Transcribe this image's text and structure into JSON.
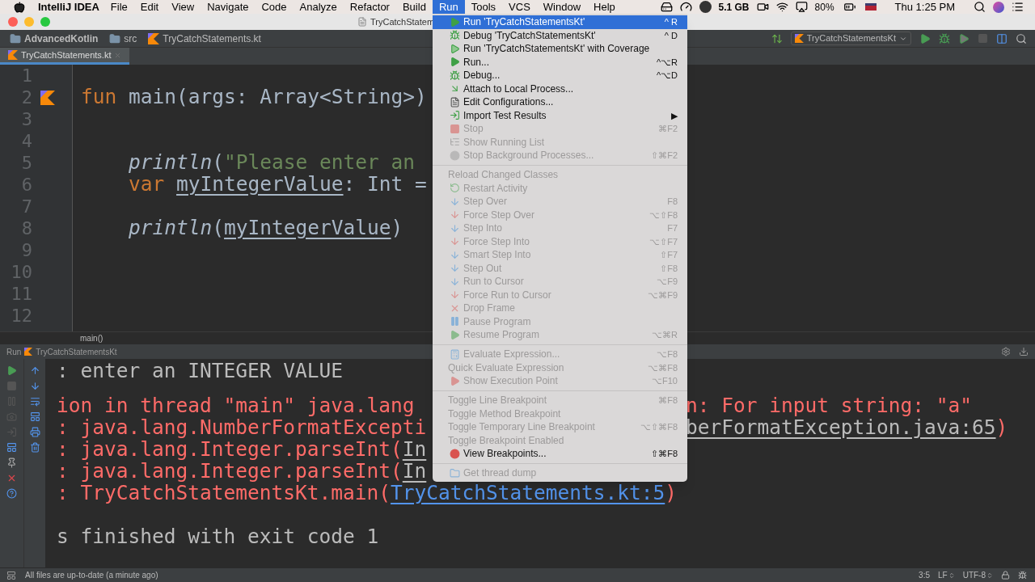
{
  "menubar": {
    "app_name": "IntelliJ IDEA",
    "items": [
      {
        "label": "File",
        "selected": false
      },
      {
        "label": "Edit",
        "selected": false
      },
      {
        "label": "View",
        "selected": false
      },
      {
        "label": "Navigate",
        "selected": false
      },
      {
        "label": "Code",
        "selected": false
      },
      {
        "label": "Analyze",
        "selected": false
      },
      {
        "label": "Refactor",
        "selected": false
      },
      {
        "label": "Build",
        "selected": false
      },
      {
        "label": "Run",
        "selected": true
      },
      {
        "label": "Tools",
        "selected": false
      },
      {
        "label": "VCS",
        "selected": false
      },
      {
        "label": "Window",
        "selected": false
      },
      {
        "label": "Help",
        "selected": false
      }
    ],
    "memory": "5.1 GB",
    "battery": "80%",
    "clock": "Thu 1:25 PM"
  },
  "window": {
    "title": "TryCatchStatem"
  },
  "navbar": {
    "breadcrumbs": [
      "AdvancedKotlin",
      "src",
      "TryCatchStatements.kt"
    ],
    "run_config": "TryCatchStatementsKt"
  },
  "tabs": [
    {
      "label": "TryCatchStatements.kt",
      "selected": true
    }
  ],
  "editor": {
    "lines": [
      {
        "number": "1",
        "run_marker": false
      },
      {
        "number": "2",
        "run_marker": true,
        "tokens": [
          {
            "text": "fun ",
            "kind": "keyword"
          },
          {
            "text": "main(args: Array<String>)",
            "kind": "plain"
          }
        ]
      },
      {
        "number": "3",
        "run_marker": false
      },
      {
        "number": "4",
        "run_marker": false
      },
      {
        "number": "5",
        "run_marker": false,
        "tokens": [
          {
            "text": "    println",
            "kind": "call"
          },
          {
            "text": "(",
            "kind": "plain"
          },
          {
            "text": "\"Please enter an",
            "kind": "string"
          }
        ]
      },
      {
        "number": "6",
        "run_marker": false,
        "tokens": [
          {
            "text": "    var ",
            "kind": "keyword"
          },
          {
            "text": "myIntegerValue",
            "kind": "variable"
          },
          {
            "text": ": Int =",
            "kind": "plain"
          }
        ]
      },
      {
        "number": "7",
        "run_marker": false
      },
      {
        "number": "8",
        "run_marker": false,
        "tokens": [
          {
            "text": "    println",
            "kind": "call"
          },
          {
            "text": "(",
            "kind": "plain"
          },
          {
            "text": "myIntegerValue",
            "kind": "variable"
          },
          {
            "text": ")",
            "kind": "plain"
          }
        ]
      },
      {
        "number": "9",
        "run_marker": false
      },
      {
        "number": "10",
        "run_marker": false
      },
      {
        "number": "11",
        "run_marker": false
      },
      {
        "number": "12",
        "run_marker": false
      }
    ],
    "breadcrumb": "main()"
  },
  "run_panel": {
    "title": "Run",
    "config": "TryCatchStatementsKt",
    "lines": [
      {
        "left": [
          {
            "text": ": enter an INTEGER VALUE",
            "kind": "output"
          }
        ]
      },
      {
        "left": [
          {
            "text": "ion in thread \"main\" java.lang",
            "kind": "error"
          }
        ],
        "right": [
          {
            "text": "n: For input string: \"a\"",
            "kind": "error"
          }
        ]
      },
      {
        "left": [
          {
            "text": ": java.lang.NumberFormatExcepti",
            "kind": "error"
          }
        ],
        "right": [
          {
            "text": "berFormatException.java:65",
            "kind": "link"
          },
          {
            "text": ")",
            "kind": "error"
          }
        ]
      },
      {
        "left": [
          {
            "text": ": java.lang.Integer.parseInt(",
            "kind": "error"
          },
          {
            "text": "In",
            "kind": "link"
          }
        ]
      },
      {
        "left": [
          {
            "text": ": java.lang.Integer.parseInt(",
            "kind": "error"
          },
          {
            "text": "In",
            "kind": "link"
          }
        ]
      },
      {
        "left": [
          {
            "text": ": TryCatchStatementsKt.main(",
            "kind": "error"
          },
          {
            "text": "TryCatchStatements.kt:5",
            "kind": "filelink"
          },
          {
            "text": ")",
            "kind": "error"
          }
        ]
      },
      {
        "left": [
          {
            "text": "s finished with exit code 1",
            "kind": "output"
          }
        ]
      }
    ]
  },
  "run_menu": {
    "items": [
      {
        "kind": "run",
        "label": "Run 'TryCatchStatementsKt'",
        "shortcut": "^ R",
        "selected": true,
        "disabled": false
      },
      {
        "kind": "debug",
        "label": "Debug 'TryCatchStatementsKt'",
        "shortcut": "^ D",
        "selected": false,
        "disabled": false
      },
      {
        "kind": "coverage",
        "label": "Run 'TryCatchStatementsKt' with Coverage",
        "selected": false,
        "disabled": false
      },
      {
        "kind": "run",
        "label": "Run...",
        "shortcut": "^⌥R",
        "selected": false,
        "disabled": false
      },
      {
        "kind": "debug",
        "label": "Debug...",
        "shortcut": "^⌥D",
        "selected": false,
        "disabled": false
      },
      {
        "kind": "attach",
        "label": "Attach to Local Process...",
        "selected": false,
        "disabled": false
      },
      {
        "kind": "edit",
        "label": "Edit Configurations...",
        "selected": false,
        "disabled": false
      },
      {
        "kind": "import",
        "label": "Import Test Results",
        "shortcut": "▶",
        "selected": false,
        "disabled": false
      },
      {
        "kind": "stop",
        "label": "Stop",
        "shortcut": "⌘F2",
        "selected": false,
        "disabled": true
      },
      {
        "kind": "list",
        "label": "Show Running List",
        "selected": false,
        "disabled": true
      },
      {
        "kind": "halt",
        "label": "Stop Background Processes...",
        "shortcut": "⇧⌘F2",
        "selected": false,
        "disabled": true
      },
      {
        "kind": "separator"
      },
      {
        "kind": "plain",
        "label": "Reload Changed Classes",
        "selected": false,
        "disabled": true
      },
      {
        "kind": "restart",
        "label": "Restart Activity",
        "selected": false,
        "disabled": true
      },
      {
        "kind": "step",
        "label": "Step Over",
        "shortcut": "F8",
        "selected": false,
        "disabled": true
      },
      {
        "kind": "force",
        "label": "Force Step Over",
        "shortcut": "⌥⇧F8",
        "selected": false,
        "disabled": true
      },
      {
        "kind": "step",
        "label": "Step Into",
        "shortcut": "F7",
        "selected": false,
        "disabled": true
      },
      {
        "kind": "force",
        "label": "Force Step Into",
        "shortcut": "⌥⇧F7",
        "selected": false,
        "disabled": true
      },
      {
        "kind": "step",
        "label": "Smart Step Into",
        "shortcut": "⇧F7",
        "selected": false,
        "disabled": true
      },
      {
        "kind": "step",
        "label": "Step Out",
        "shortcut": "⇧F8",
        "selected": false,
        "disabled": true
      },
      {
        "kind": "step",
        "label": "Run to Cursor",
        "shortcut": "⌥F9",
        "selected": false,
        "disabled": true
      },
      {
        "kind": "force",
        "label": "Force Run to Cursor",
        "shortcut": "⌥⌘F9",
        "selected": false,
        "disabled": true
      },
      {
        "kind": "drop",
        "label": "Drop Frame",
        "selected": false,
        "disabled": true
      },
      {
        "kind": "pause",
        "label": "Pause Program",
        "selected": false,
        "disabled": true
      },
      {
        "kind": "run",
        "label": "Resume Program",
        "shortcut": "⌥⌘R",
        "selected": false,
        "disabled": true
      },
      {
        "kind": "separator"
      },
      {
        "kind": "evaluate",
        "label": "Evaluate Expression...",
        "shortcut": "⌥F8",
        "selected": false,
        "disabled": true
      },
      {
        "kind": "plain",
        "label": "Quick Evaluate Expression",
        "shortcut": "⌥⌘F8",
        "selected": false,
        "disabled": true
      },
      {
        "kind": "point",
        "label": "Show Execution Point",
        "shortcut": "⌥F10",
        "selected": false,
        "disabled": true
      },
      {
        "kind": "separator"
      },
      {
        "kind": "plain",
        "label": "Toggle Line Breakpoint",
        "shortcut": "⌘F8",
        "selected": false,
        "disabled": true
      },
      {
        "kind": "plain",
        "label": "Toggle Method Breakpoint",
        "selected": false,
        "disabled": true
      },
      {
        "kind": "plain",
        "label": "Toggle Temporary Line Breakpoint",
        "shortcut": "⌥⇧⌘F8",
        "selected": false,
        "disabled": true
      },
      {
        "kind": "plain",
        "label": "Toggle Breakpoint Enabled",
        "selected": false,
        "disabled": true
      },
      {
        "kind": "breakpoints",
        "label": "View Breakpoints...",
        "shortcut": "⇧⌘F8",
        "selected": false,
        "disabled": false
      },
      {
        "kind": "separator"
      },
      {
        "kind": "dump",
        "label": "Get thread dump",
        "selected": false,
        "disabled": true
      }
    ]
  },
  "status_bar": {
    "message": "All files are up-to-date (a minute ago)",
    "position": "3:5",
    "line_separator": "LF",
    "encoding": "UTF-8"
  }
}
